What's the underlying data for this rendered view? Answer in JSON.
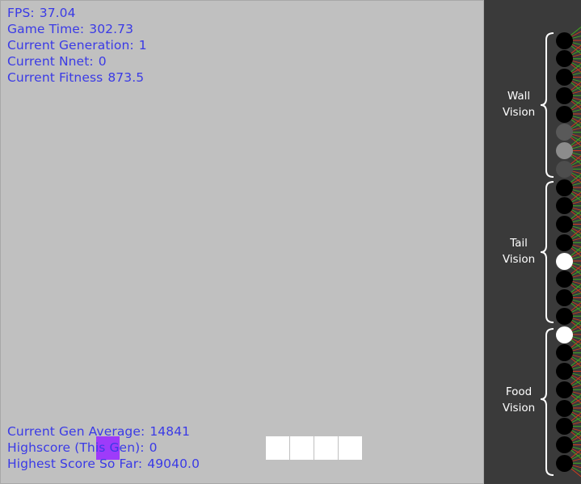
{
  "hud": {
    "fps_label": "FPS:",
    "fps_value": "37.04",
    "game_time_label": "Game Time:",
    "game_time_value": "302.73",
    "generation_label": "Current Generation:",
    "generation_value": "1",
    "nnet_label": "Current Nnet:",
    "nnet_value": "0",
    "fitness_label": "Current Fitness",
    "fitness_value": "873.5",
    "gen_average_label": "Current Gen Average:",
    "gen_average_value": "14841",
    "highscore_gen_label": "Highscore (This Gen):",
    "highscore_gen_value": "0",
    "highest_score_label": "Highest Score So Far:",
    "highest_score_value": "49040.0"
  },
  "colors": {
    "board": "#c0c0c0",
    "hud_text": "#3a3ae6",
    "food": "#9b30ff",
    "snake": "#ffffff",
    "panel": "#3a3a3a",
    "connection_red": "#d23a1e",
    "connection_green": "#3fae1c"
  },
  "nnet": {
    "groups": [
      {
        "label_line1": "Wall",
        "label_line2": "Vision",
        "activations": [
          0.0,
          0.0,
          0.0,
          0.0,
          0.0,
          0.35,
          0.55,
          0.3
        ]
      },
      {
        "label_line1": "Tail",
        "label_line2": "Vision",
        "activations": [
          0.0,
          0.0,
          0.0,
          0.0,
          1.0,
          0.0,
          0.0,
          0.0
        ]
      },
      {
        "label_line1": "Food",
        "label_line2": "Vision",
        "activations": [
          1.0,
          0.0,
          0.0,
          0.0,
          0.0,
          0.0,
          0.0,
          0.0
        ]
      }
    ]
  }
}
